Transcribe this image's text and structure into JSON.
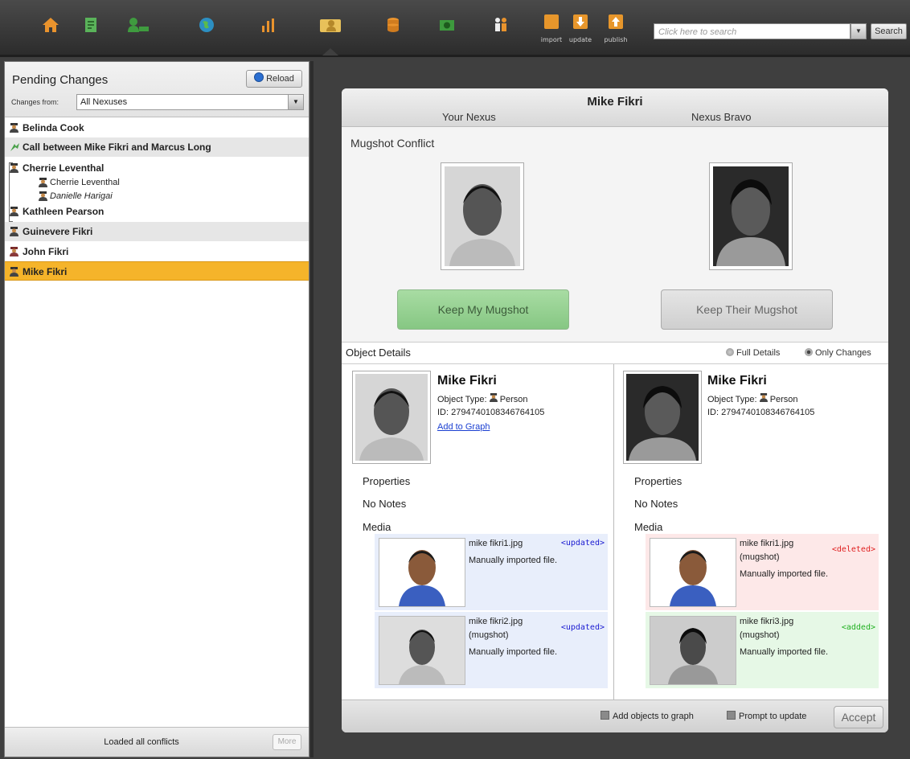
{
  "toolbar": {
    "icons": [
      "home-icon",
      "report-icon",
      "user-add-icon",
      "globe-icon",
      "bar-chart-icon",
      "people-card-icon",
      "database-icon",
      "camera-icon",
      "group-icon"
    ],
    "import_label": "import",
    "update_label": "update",
    "publish_label": "publish",
    "search_placeholder": "Click here to search",
    "search_button": "Search"
  },
  "left_panel": {
    "title": "Pending Changes",
    "reload_label": "Reload",
    "changes_from_label": "Changes from:",
    "changes_from_value": "All Nexuses",
    "items": [
      {
        "label": "Belinda Cook"
      },
      {
        "label": "Call between Mike Fikri and Marcus Long"
      },
      {
        "label": "Cherrie Leventhal"
      },
      {
        "label": "Cherrie Leventhal"
      },
      {
        "label": "Danielle Harigai"
      },
      {
        "label": "Kathleen Pearson"
      },
      {
        "label": "Guinevere Fikri"
      },
      {
        "label": "John Fikri"
      },
      {
        "label": "Mike Fikri"
      }
    ],
    "footer_text": "Loaded all conflicts",
    "more_label": "More"
  },
  "dialog": {
    "title": "Mike Fikri",
    "left_col": "Your Nexus",
    "right_col": "Nexus Bravo",
    "mugshot_conflict": "Mugshot Conflict",
    "keep_my": "Keep My Mugshot",
    "keep_their": "Keep Their Mugshot",
    "object_details": "Object Details",
    "full_details": "Full Details",
    "only_changes": "Only Changes",
    "left": {
      "name": "Mike Fikri",
      "type": "Object Type:",
      "type_value": "Person",
      "id": "ID: 2794740108346764105",
      "add_to_graph": "Add to Graph",
      "properties": "Properties",
      "notes": "No Notes",
      "media": "Media",
      "media_items": [
        {
          "file": "mike fikri1.jpg",
          "sub": "",
          "note": "Manually imported file.",
          "tag": "<updated>"
        },
        {
          "file": "mike fikri2.jpg",
          "sub": "(mugshot)",
          "note": "Manually imported file.",
          "tag": "<updated>"
        }
      ]
    },
    "right": {
      "name": "Mike Fikri",
      "type": "Object Type:",
      "type_value": "Person",
      "id": "ID: 2794740108346764105",
      "properties": "Properties",
      "notes": "No Notes",
      "media": "Media",
      "media_items": [
        {
          "file": "mike fikri1.jpg",
          "sub": "(mugshot)",
          "note": "Manually imported file.",
          "tag": "<deleted>"
        },
        {
          "file": "mike fikri3.jpg",
          "sub": "(mugshot)",
          "note": "Manually imported file.",
          "tag": "<added>"
        }
      ]
    },
    "footer": {
      "add_objects": "Add objects to graph",
      "prompt_update": "Prompt to update",
      "accept": "Accept"
    }
  },
  "colors": {
    "selected_row": "#f5b42a",
    "keep_my_green": "#86c783",
    "updated_blue": "#1a1ad1",
    "deleted_red": "#e02020",
    "added_green": "#20b020",
    "media_blue_bg": "#e8eefb",
    "media_red_bg": "#fde8e8",
    "media_green_bg": "#e6f8e6"
  }
}
